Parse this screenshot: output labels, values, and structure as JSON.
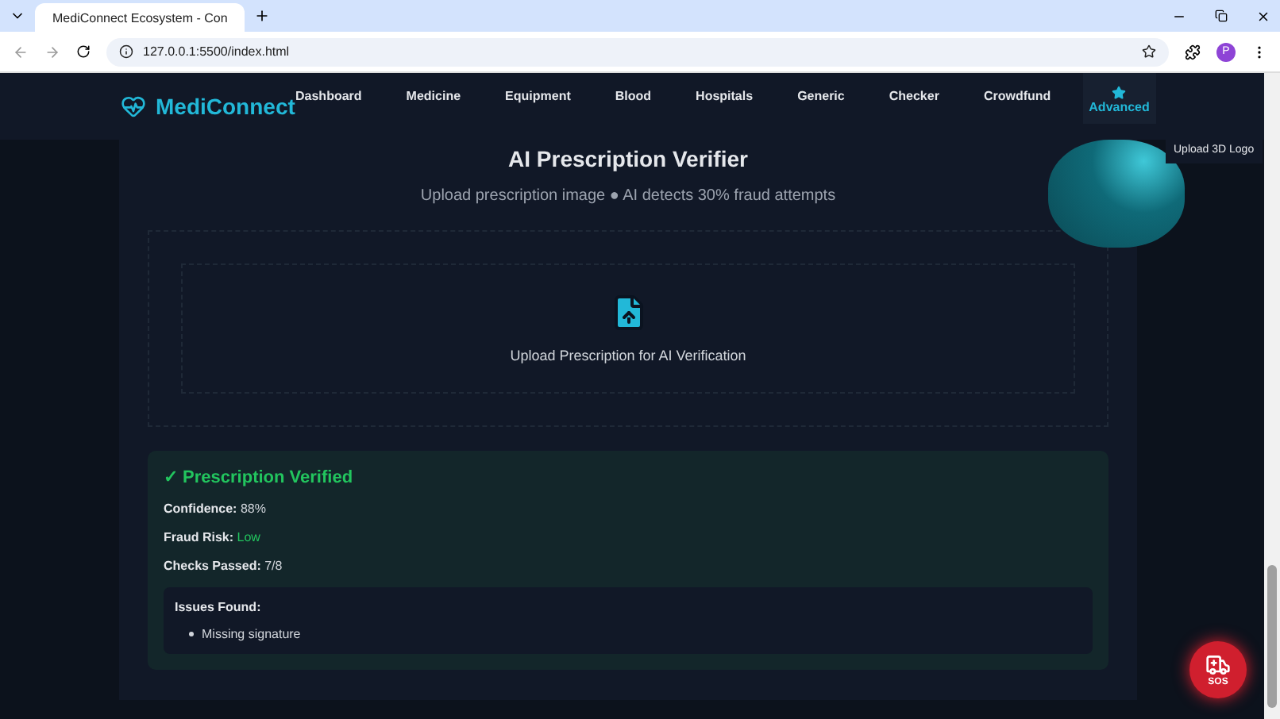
{
  "browser": {
    "tab_title": "MediConnect Ecosystem - Con",
    "url": "127.0.0.1:5500/index.html",
    "profile": "P"
  },
  "nav": {
    "brand": "MediConnect",
    "items": [
      {
        "label": "Dashboard",
        "selected": false
      },
      {
        "label": "Medicine",
        "selected": false
      },
      {
        "label": "Equipment",
        "selected": false
      },
      {
        "label": "Blood",
        "selected": false
      },
      {
        "label": "Hospitals",
        "selected": false
      },
      {
        "label": "Generic",
        "selected": false
      },
      {
        "label": "Checker",
        "selected": false
      },
      {
        "label": "Crowdfund",
        "selected": false
      },
      {
        "label": "Advanced",
        "selected": true,
        "kind": "featured"
      }
    ]
  },
  "heading": "AI Prescription Verifier",
  "subtitle": "Upload prescription image ● AI detects 30% fraud attempts",
  "upload": {
    "label": "Upload Prescription for AI Verification"
  },
  "result": {
    "title": "✓ Prescription Verified",
    "fields": [
      {
        "label": "Confidence:",
        "value": "88%",
        "kind": "plain"
      },
      {
        "label": "Fraud Risk:",
        "value": "Low",
        "kind": "risk"
      },
      {
        "label": "Checks Passed:",
        "value": "7/8",
        "kind": "plain"
      }
    ],
    "issues": {
      "title": "Issues Found:",
      "items": [
        "Missing signature"
      ]
    }
  },
  "logo_button": "Upload 3D Logo",
  "sos": "SOS"
}
